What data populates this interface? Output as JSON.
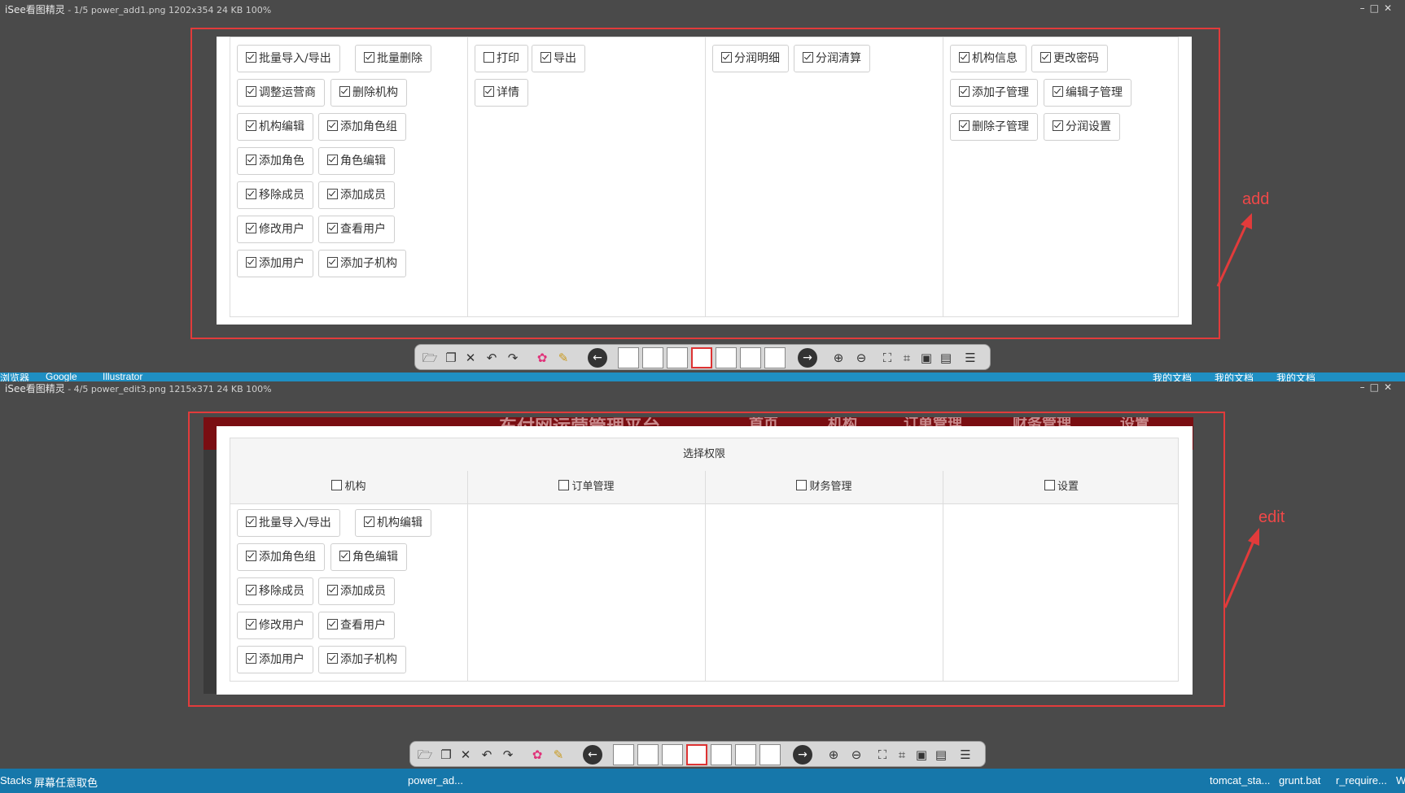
{
  "top_window": {
    "title_app": "iSee看图精灵",
    "title_info": "- 1/5  power_add1.png  1202x354  24 KB  100%",
    "annotation": "add",
    "columns": [
      {
        "items": [
          {
            "label": "批量导入/导出",
            "checked": true
          },
          {
            "label": "批量删除",
            "checked": true
          },
          {
            "label": "调整运营商",
            "checked": true
          },
          {
            "label": "删除机构",
            "checked": true
          },
          {
            "label": "机构编辑",
            "checked": true
          },
          {
            "label": "添加角色组",
            "checked": true
          },
          {
            "label": "添加角色",
            "checked": true
          },
          {
            "label": "角色编辑",
            "checked": true
          },
          {
            "label": "移除成员",
            "checked": true
          },
          {
            "label": "添加成员",
            "checked": true
          },
          {
            "label": "修改用户",
            "checked": true
          },
          {
            "label": "查看用户",
            "checked": true
          },
          {
            "label": "添加用户",
            "checked": true
          },
          {
            "label": "添加子机构",
            "checked": true
          }
        ]
      },
      {
        "items": [
          {
            "label": "打印",
            "checked": false
          },
          {
            "label": "导出",
            "checked": true
          },
          {
            "label": "详情",
            "checked": true
          }
        ]
      },
      {
        "items": [
          {
            "label": "分润明细",
            "checked": true
          },
          {
            "label": "分润清算",
            "checked": true
          }
        ]
      },
      {
        "items": [
          {
            "label": "机构信息",
            "checked": true
          },
          {
            "label": "更改密码",
            "checked": true
          },
          {
            "label": "添加子管理",
            "checked": true
          },
          {
            "label": "编辑子管理",
            "checked": true
          },
          {
            "label": "删除子管理",
            "checked": true
          },
          {
            "label": "分润设置",
            "checked": true
          }
        ]
      }
    ]
  },
  "separator_strip": {
    "items": [
      "浏览器",
      "Google",
      "Illustrator",
      "我的文档",
      "我的文档",
      "我的文档"
    ]
  },
  "bottom_window": {
    "title_app": "iSee看图精灵",
    "title_info": "- 4/5  power_edit3.png  1215x371  24 KB  100%",
    "annotation": "edit",
    "banner_text": "东付网运营管理平台",
    "banner_nav": [
      "首页",
      "机构",
      "订单管理",
      "财务管理",
      "设置"
    ],
    "panel_title": "选择权限",
    "headers": [
      {
        "label": "机构",
        "checked": false
      },
      {
        "label": "订单管理",
        "checked": false
      },
      {
        "label": "财务管理",
        "checked": false
      },
      {
        "label": "设置",
        "checked": false
      }
    ],
    "items": [
      {
        "label": "批量导入/导出",
        "checked": true
      },
      {
        "label": "机构编辑",
        "checked": true
      },
      {
        "label": "添加角色组",
        "checked": true
      },
      {
        "label": "角色编辑",
        "checked": true
      },
      {
        "label": "移除成员",
        "checked": true
      },
      {
        "label": "添加成员",
        "checked": true
      },
      {
        "label": "修改用户",
        "checked": true
      },
      {
        "label": "查看用户",
        "checked": true
      },
      {
        "label": "添加用户",
        "checked": true
      },
      {
        "label": "添加子机构",
        "checked": true
      }
    ]
  },
  "taskbar": {
    "items": [
      "Stacks",
      "屏幕任意取色",
      "power_ad...",
      "tomcat_sta...",
      "grunt.bat",
      "r_require...",
      "W"
    ]
  },
  "colors": {
    "frame_red": "#e23b3b",
    "window_bg": "#4a4a4a",
    "taskbar_blue": "#1677aa"
  }
}
